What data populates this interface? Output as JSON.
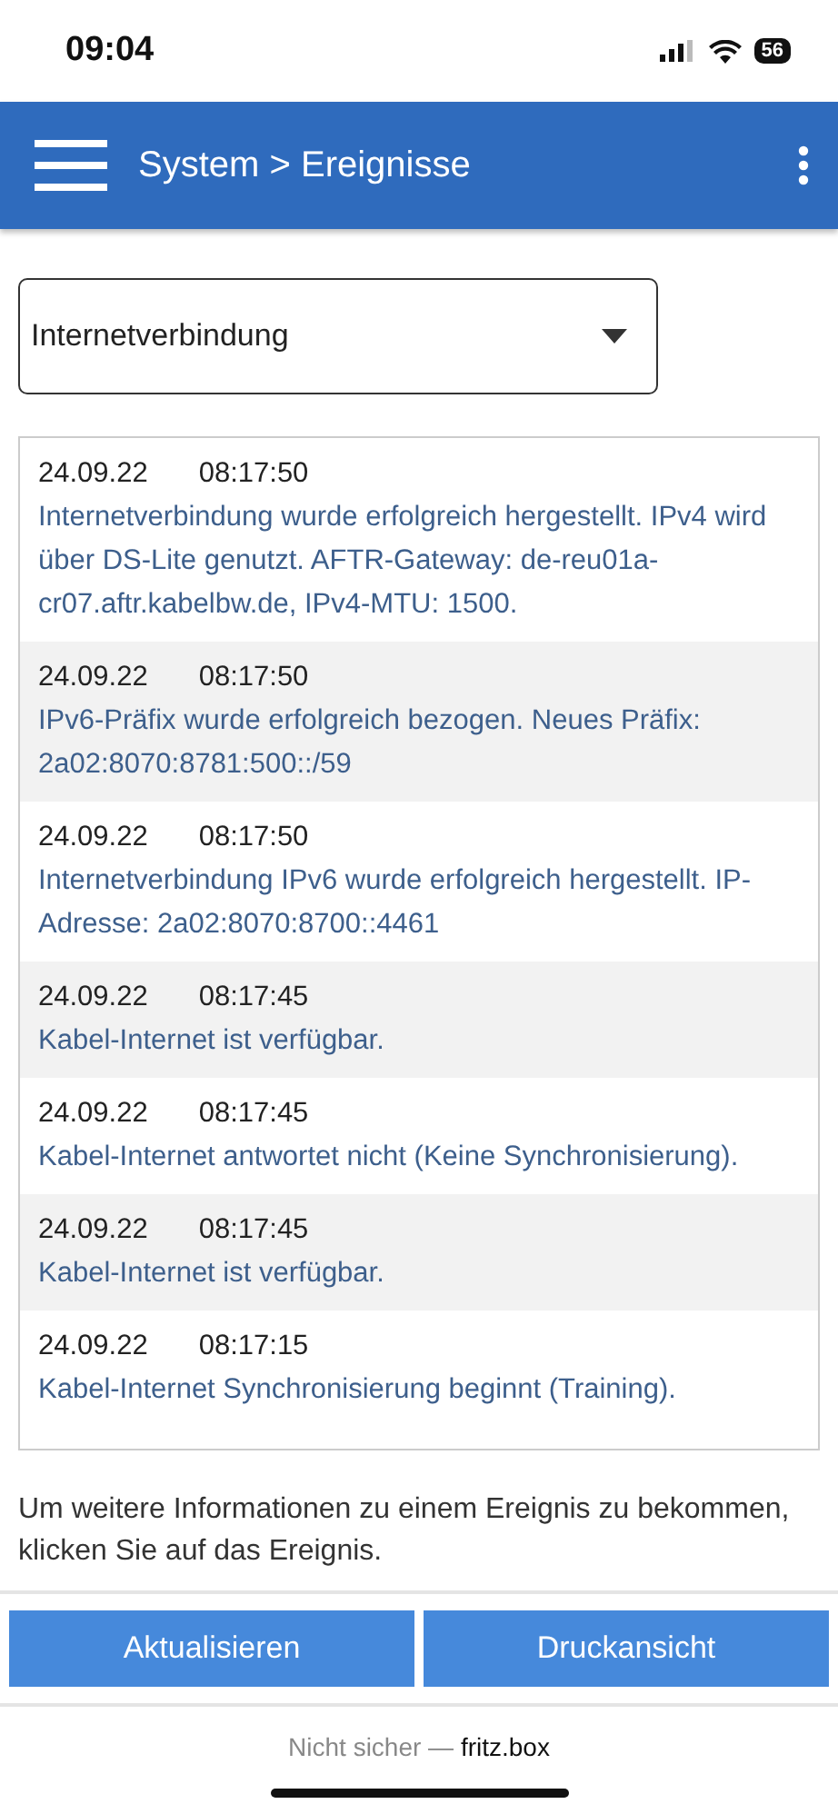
{
  "status_bar": {
    "time": "09:04",
    "battery": "56"
  },
  "header": {
    "title": "System > Ereignisse"
  },
  "filter": {
    "value": "Internetverbindung"
  },
  "events": [
    {
      "date": "24.09.22",
      "time": "08:17:50",
      "message": "Internetverbindung wurde erfolgreich hergestellt. IPv4 wird über DS-Lite genutzt. AFTR-Gateway: de-reu01a-cr07.aftr.kabelbw.de, IPv4-MTU: 1500."
    },
    {
      "date": "24.09.22",
      "time": "08:17:50",
      "message": "IPv6-Präfix wurde erfolgreich bezogen. Neues Präfix: 2a02:8070:8781:500::/59"
    },
    {
      "date": "24.09.22",
      "time": "08:17:50",
      "message": "Internetverbindung IPv6 wurde erfolgreich hergestellt. IP-Adresse: 2a02:8070:8700::4461"
    },
    {
      "date": "24.09.22",
      "time": "08:17:45",
      "message": "Kabel-Internet ist verfügbar."
    },
    {
      "date": "24.09.22",
      "time": "08:17:45",
      "message": "Kabel-Internet antwortet nicht (Keine Synchronisierung)."
    },
    {
      "date": "24.09.22",
      "time": "08:17:45",
      "message": "Kabel-Internet ist verfügbar."
    },
    {
      "date": "24.09.22",
      "time": "08:17:15",
      "message": "Kabel-Internet Synchronisierung beginnt (Training)."
    }
  ],
  "hint": "Um weitere Informationen zu einem Ereignis zu bekommen, klicken Sie auf das Ereignis.",
  "buttons": [
    "Aktualisieren",
    "Druckansicht"
  ],
  "address_bar": {
    "security": "Nicht sicher —",
    "host": "fritz.box"
  }
}
